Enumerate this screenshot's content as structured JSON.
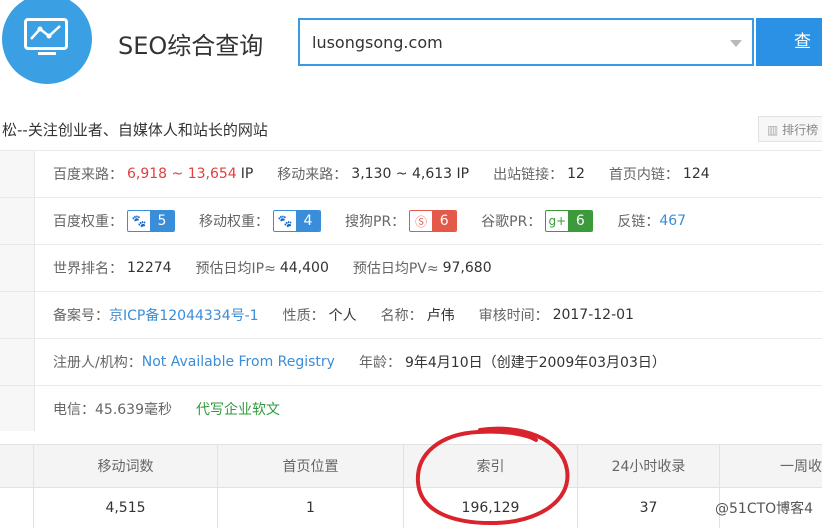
{
  "header": {
    "title": "SEO综合查询",
    "search_value": "lusongsong.com",
    "search_button": "查"
  },
  "site": {
    "description": "松--关注创业者、自媒体人和站长的网站",
    "rank_button": "排行榜"
  },
  "info": {
    "row1": [
      {
        "label": "百度来路：",
        "value": "6,918 ~ 13,654",
        "unit": "IP"
      },
      {
        "label": "移动来路：",
        "value": "3,130 ~ 4,613 IP"
      },
      {
        "label": "出站链接：",
        "value": "12"
      },
      {
        "label": "首页内链：",
        "value": "124"
      }
    ],
    "row2": {
      "baidu_label": "百度权重：",
      "baidu_value": "5",
      "mobile_label": "移动权重：",
      "mobile_value": "4",
      "sogou_label": "搜狗PR：",
      "sogou_value": "6",
      "google_label": "谷歌PR：",
      "google_value": "6",
      "backlink_label": "反链：",
      "backlink_value": "467"
    },
    "row3": [
      {
        "label": "世界排名：",
        "value": "12274"
      },
      {
        "label": "预估日均IP≈",
        "value": "44,400"
      },
      {
        "label": "预估日均PV≈",
        "value": "97,680"
      }
    ],
    "row4": {
      "icp_label": "备案号：",
      "icp_value": "京ICP备12044334号-1",
      "nature_label": "性质：",
      "nature_value": "个人",
      "name_label": "名称：",
      "name_value": "卢伟",
      "audit_label": "审核时间：",
      "audit_value": "2017-12-01"
    },
    "row5": {
      "registrant_label": "注册人/机构：",
      "registrant_value": "Not Available From Registry",
      "age_label": "年龄：",
      "age_value": "9年4月10日（创建于2009年03月03日）"
    },
    "row6": {
      "telecom": "电信：45.639毫秒",
      "ad": "代写企业软文"
    }
  },
  "table": {
    "headers": [
      "移动词数",
      "首页位置",
      "索引",
      "24小时收录",
      "一周收"
    ],
    "values": [
      "4,515",
      "1",
      "196,129",
      "37",
      ""
    ]
  },
  "watermark": "@51CTO博客4",
  "colors": {
    "accent": "#2b91e4",
    "annotation": "#d9232d"
  }
}
